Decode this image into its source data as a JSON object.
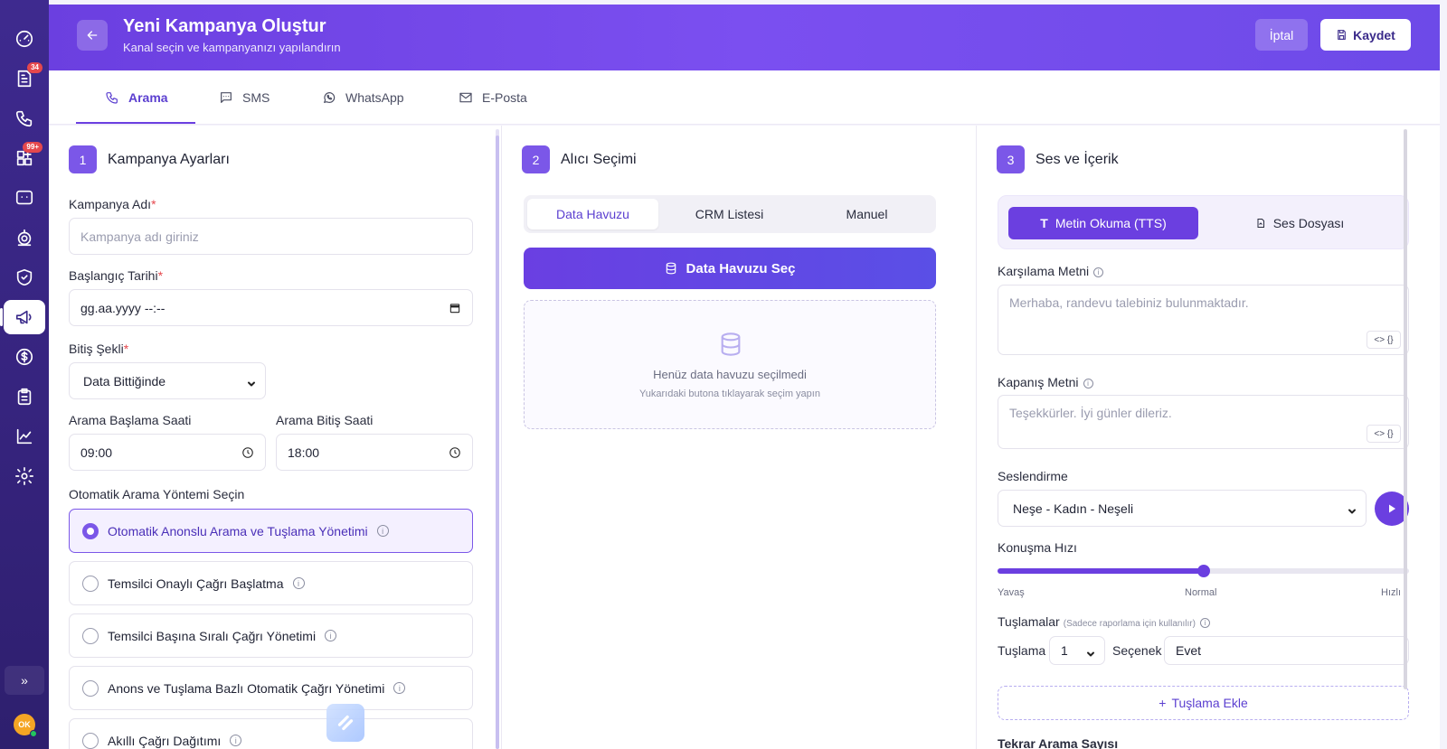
{
  "sidebar": {
    "items": [
      {
        "icon": "dashboard-icon"
      },
      {
        "icon": "reports-icon",
        "badge": "34"
      },
      {
        "icon": "phone-icon"
      },
      {
        "icon": "widgets-icon",
        "badge": "99+"
      },
      {
        "icon": "chat-icon"
      },
      {
        "icon": "robot-icon"
      },
      {
        "icon": "shield-icon"
      },
      {
        "icon": "megaphone-icon",
        "active": true
      },
      {
        "icon": "dollar-icon"
      },
      {
        "icon": "clipboard-icon"
      },
      {
        "icon": "chart-icon"
      },
      {
        "icon": "settings-icon"
      }
    ],
    "expand_label": "»",
    "avatar_initials": "OK"
  },
  "header": {
    "title": "Yeni Kampanya Oluştur",
    "subtitle": "Kanal seçin ve kampanyanızı yapılandırın",
    "cancel_label": "İptal",
    "save_label": "Kaydet"
  },
  "tabs": [
    {
      "label": "Arama",
      "icon": "phone-icon",
      "active": true
    },
    {
      "label": "SMS",
      "icon": "message-icon"
    },
    {
      "label": "WhatsApp",
      "icon": "whatsapp-icon"
    },
    {
      "label": "E-Posta",
      "icon": "mail-icon"
    }
  ],
  "section1": {
    "num": "1",
    "title": "Kampanya Ayarları",
    "name_label": "Kampanya Adı",
    "name_placeholder": "Kampanya adı giriniz",
    "start_label": "Başlangıç Tarihi",
    "start_value": "gg.aa.yyyy --:--",
    "end_label": "Bitiş Şekli",
    "end_value": "Data Bittiğinde",
    "call_start_label": "Arama Başlama Saati",
    "call_start_value": "09:00",
    "call_end_label": "Arama Bitiş Saati",
    "call_end_value": "18:00",
    "method_label": "Otomatik Arama Yöntemi Seçin",
    "methods": [
      {
        "label": "Otomatik Anonslu Arama ve Tuşlama Yönetimi",
        "selected": true
      },
      {
        "label": "Temsilci Onaylı Çağrı Başlatma"
      },
      {
        "label": "Temsilci Başına Sıralı Çağrı Yönetimi"
      },
      {
        "label": "Anons ve Tuşlama Bazlı Otomatik Çağrı Yönetimi"
      },
      {
        "label": "Akıllı Çağrı Dağıtımı"
      }
    ]
  },
  "section2": {
    "num": "2",
    "title": "Alıcı Seçimi",
    "segments": [
      "Data Havuzu",
      "CRM Listesi",
      "Manuel"
    ],
    "select_button": "Data Havuzu Seç",
    "empty_title": "Henüz data havuzu seçilmedi",
    "empty_hint": "Yukarıdaki butona tıklayarak seçim yapın"
  },
  "section3": {
    "num": "3",
    "title": "Ses ve İçerik",
    "mode_tts": "Metin Okuma (TTS)",
    "mode_file": "Ses Dosyası",
    "greeting_label": "Karşılama Metni",
    "greeting_placeholder": "Merhaba, randevu talebiniz bulunmaktadır.",
    "closing_label": "Kapanış Metni",
    "closing_placeholder": "Teşekkürler. İyi günler dileriz.",
    "variable_btn": "<> {}",
    "voice_label": "Seslendirme",
    "voice_value": "Neşe - Kadın - Neşeli",
    "speed_label": "Konuşma Hızı",
    "speed_value": 0.5,
    "speed_slow": "Yavaş",
    "speed_normal": "Normal",
    "speed_fast": "Hızlı",
    "keys_label": "Tuşlamalar",
    "keys_note": "(Sadece raporlama için kullanılır)",
    "key_label": "Tuşlama",
    "key_value": "1",
    "option_label": "Seçenek",
    "option_value": "Evet",
    "add_key_label": "Tuşlama Ekle",
    "retry_label": "Tekrar Arama Sayısı"
  },
  "colors": {
    "accent": "#6b3fe0",
    "sidebar": "#3e2a8f",
    "badge": "#e5484d"
  }
}
